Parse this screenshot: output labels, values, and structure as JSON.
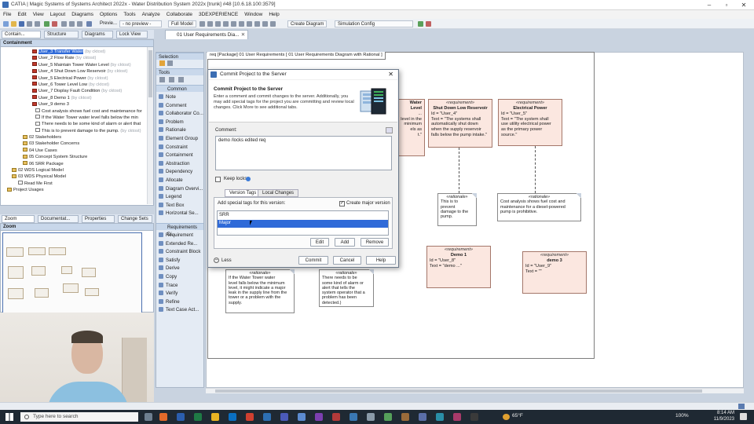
{
  "window": {
    "title": "CATIA | Magic Systems of Systems Architect 2022x - Water Distribution System 2022x [trunk] #48 [10.6.18.100:3579]"
  },
  "menu": [
    "File",
    "Edit",
    "View",
    "Layout",
    "Diagrams",
    "Options",
    "Tools",
    "Analyze",
    "Collaborate",
    "3DEXPERIENCE",
    "Window",
    "Help"
  ],
  "toolbar": {
    "preview": "Previe...",
    "no_preview": "- no preview -",
    "full_model": "Full Model",
    "create_diagram": "Create Diagram",
    "sim_config": "Simulation Config"
  },
  "left_tabs": [
    "Contain...",
    "Structure",
    "Diagrams",
    "Lock View"
  ],
  "containment": {
    "title": "Containment",
    "items": [
      {
        "label": "User_3 Transfer Water",
        "owner": "(by cktost)",
        "type": "req",
        "selected": true
      },
      {
        "label": "User_2 Flow Rate",
        "owner": "(by cktost)",
        "type": "req"
      },
      {
        "label": "User_5 Maintain Tower Water Level",
        "owner": "(by cktost)",
        "type": "req"
      },
      {
        "label": "User_4 Shut Down Low Reservoir",
        "owner": "(by cktost)",
        "type": "req"
      },
      {
        "label": "User_5 Electrical Power",
        "owner": "(by cktost)",
        "type": "req"
      },
      {
        "label": "User_6 Tower Level Low",
        "owner": "(by cktost)",
        "type": "req"
      },
      {
        "label": "User_7 Display Fault Condition",
        "owner": "(by cktost)",
        "type": "req"
      },
      {
        "label": "User_8 Demo 1",
        "owner": "(by cktost)",
        "type": "req"
      },
      {
        "label": "User_9 demo 3",
        "owner": "",
        "type": "req"
      },
      {
        "label": "Cost analysis shows fuel cost and maintenance for",
        "owner": "",
        "type": "note"
      },
      {
        "label": "If the Water Tower water level falls below the min",
        "owner": "",
        "type": "note"
      },
      {
        "label": "There needs to be some kind of alarm or alert that",
        "owner": "",
        "type": "note"
      },
      {
        "label": "This is to prevent damage to the pump.",
        "owner": "(by cktost)",
        "type": "note"
      },
      {
        "label": "02 Stakeholders",
        "owner": "",
        "type": "pkg"
      },
      {
        "label": "03 Stakeholder Concerns",
        "owner": "",
        "type": "pkg"
      },
      {
        "label": "04 Use Cases",
        "owner": "",
        "type": "pkg"
      },
      {
        "label": "05 Concept System Structure",
        "owner": "",
        "type": "pkg"
      },
      {
        "label": "06 SRR Package",
        "owner": "",
        "type": "pkg"
      },
      {
        "label": "02 WDS Logical Model",
        "owner": "",
        "type": "pkg"
      },
      {
        "label": "03 WDS Physical Model",
        "owner": "",
        "type": "pkg"
      },
      {
        "label": "Read Me First",
        "owner": "",
        "type": "note"
      },
      {
        "label": "Project Usages",
        "owner": "",
        "type": "pkg"
      }
    ]
  },
  "bottom_tabs": [
    "Zoom",
    "Documentat...",
    "Properties",
    "Change Sets"
  ],
  "zoom": {
    "title": "Zoom"
  },
  "tools": {
    "selection": "Selection",
    "title": "Tools",
    "common_group": "Common",
    "common": [
      "Note",
      "Comment",
      "Collaborator Co...",
      "Problem",
      "Rationale",
      "Element Group",
      "Constraint",
      "Containment",
      "Abstraction",
      "Dependency",
      "Allocate",
      "Diagram Overvi...",
      "Legend",
      "Text Box",
      "Horizontal Se..."
    ],
    "req_group": "Requirements Di...",
    "req": [
      "Requirement",
      "Extended Re...",
      "Constraint Block",
      "Satisfy",
      "Derive",
      "Copy",
      "Trace",
      "Verify",
      "Refine",
      "Text Case Act..."
    ]
  },
  "doc_tab": "01 User Requirements Dia...",
  "diagram": {
    "label": "req [Package] 01 User Requirements [ 01 User Requirements Diagram with Rational ]",
    "requirements": [
      {
        "id": "r1",
        "stereo": "«requirement»",
        "name": "Water Level",
        "lines": [
          "Id = \"User_3\"",
          "Text = \"The systems shall",
          "...",
          "level in the",
          "minimum",
          "els as",
          "t.\""
        ]
      },
      {
        "id": "r2",
        "stereo": "«requirement»",
        "name": "Shut Down Low Reservoir",
        "lines": [
          "Id = \"User_4\"",
          "Text = \"The systems shall",
          "automatically shut down",
          "when the supply reservoir",
          "falls below the pump intake.\""
        ]
      },
      {
        "id": "r3",
        "stereo": "«requirement»",
        "name": "Electrical Power",
        "lines": [
          "Id = \"User_5\"",
          "Text = \"The system shall",
          "use utility electrical power",
          "as the primary power",
          "source.\""
        ]
      },
      {
        "id": "r4",
        "stereo": "«requirement»",
        "name": "Demo 1",
        "lines": [
          "Id = \"User_8\"",
          "Text = \"demo ...\""
        ]
      },
      {
        "id": "r5",
        "stereo": "«requirement»",
        "name": "demo 3",
        "lines": [
          "Id = \"User_9\"",
          "Text = \"\""
        ]
      }
    ],
    "rationales": [
      {
        "stereo": "«rationale»",
        "lines": [
          "This is to",
          "prevent",
          "damage to the",
          "pump."
        ]
      },
      {
        "stereo": "«rationale»",
        "lines": [
          "Cost analysis shows fuel cost and",
          "maintenance for a diesel-powered",
          "pump is prohibitive."
        ]
      },
      {
        "stereo": "«rationale»",
        "lines": [
          "If the Water Tower water",
          "level falls below the minimum",
          "level, it might indicate a major",
          "leak in the supply line from the",
          "tower or a problem with the",
          "supply."
        ]
      },
      {
        "stereo": "«rationale»",
        "lines": [
          "There needs to be",
          "some kind of alarm or",
          "alert that tells the",
          "system operator that a",
          "problem has been",
          "detected.)"
        ]
      }
    ]
  },
  "dialog": {
    "title": "Commit Project to the Server",
    "heading": "Commit Project to the Server",
    "description": "Enter a comment and commit changes to the server. Additionally, you may add special tags for the project you are committing and review local changes. Click More to see additional tabs.",
    "comment_label": "Comment:",
    "comment_value": "demo /locks edited req",
    "keep_locks": "Keep locks",
    "tabs": [
      "Version Tags",
      "Local Changes"
    ],
    "tags_label": "Add special tags for this version:",
    "create_major": "Create major version",
    "tags": [
      {
        "label": "SRR",
        "selected": false
      },
      {
        "label": "Major",
        "selected": true
      }
    ],
    "edit": "Edit",
    "add": "Add",
    "remove": "Remove",
    "less": "Less",
    "commit": "Commit",
    "cancel": "Cancel",
    "help": "Help"
  },
  "taskbar": {
    "search_placeholder": "Type here to search",
    "temp": "65°F",
    "time": "8:14 AM",
    "date": "11/9/2023",
    "zoom": "100%"
  },
  "colors": {
    "selection": "#2f6ad8",
    "requirement_fill": "#fbe7e0",
    "tools_bg": "#e4ebf4"
  }
}
